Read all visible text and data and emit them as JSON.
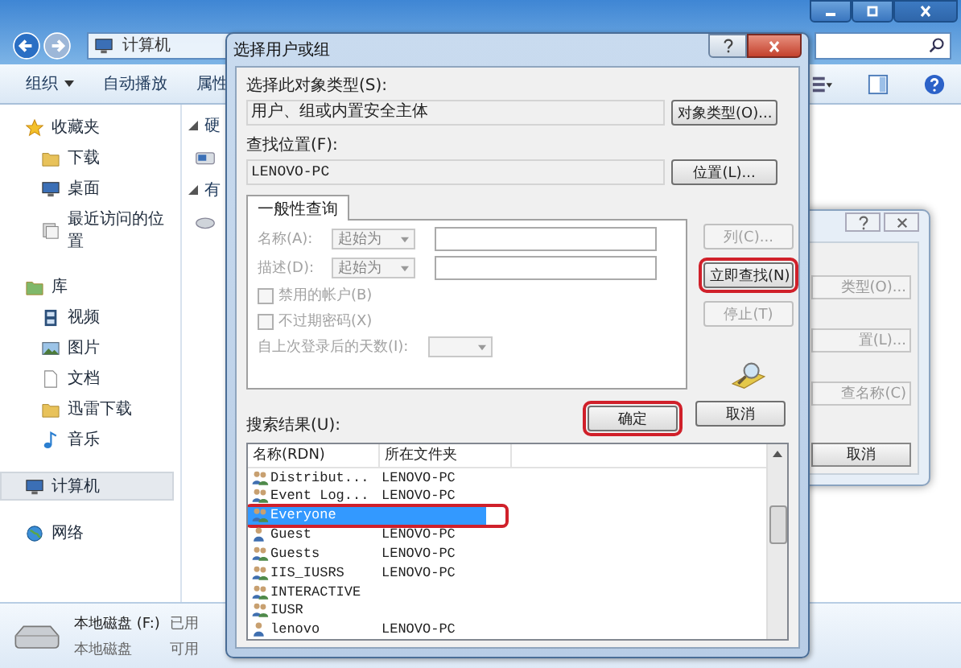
{
  "explorer": {
    "breadcrumb": "计算机",
    "toolbar": [
      {
        "label": "组织",
        "dropdown": true
      },
      {
        "label": "自动播放",
        "dropdown": false
      },
      {
        "label": "属性",
        "dropdown": false
      }
    ],
    "sidebar": [
      {
        "label": "收藏夹",
        "selected": false,
        "children": [
          {
            "label": "下载",
            "selected": false
          },
          {
            "label": "桌面",
            "selected": false
          },
          {
            "label": "最近访问的位置",
            "selected": false
          }
        ]
      },
      {
        "label": "库",
        "selected": false,
        "children": [
          {
            "label": "视频",
            "selected": false
          },
          {
            "label": "图片",
            "selected": false
          },
          {
            "label": "文档",
            "selected": false
          },
          {
            "label": "迅雷下载",
            "selected": false
          },
          {
            "label": "音乐",
            "selected": false
          }
        ]
      },
      {
        "label": "计算机",
        "selected": true
      },
      {
        "label": "网络",
        "selected": false
      }
    ],
    "content_headings": [
      "硬",
      "有"
    ],
    "details": {
      "name": "本地磁盘 (F:)",
      "type": "本地磁盘",
      "used_label": "已用",
      "free_label": "可用"
    }
  },
  "background_dialog": {
    "buttons": [
      "类型(O)...",
      "置(L)...",
      "查名称(C)",
      "取消"
    ]
  },
  "dialog": {
    "title": "选择用户或组",
    "object_type_label": "选择此对象类型(S):",
    "object_type": "用户、组或内置安全主体",
    "object_type_button": "对象类型(O)...",
    "location_label": "查找位置(F):",
    "location": "LENOVO-PC",
    "location_button": "位置(L)...",
    "tab": {
      "label": "一般性查询",
      "selected": true
    },
    "query_disabled": true,
    "query_rows": [
      {
        "label": "名称(A):",
        "operator": "起始为"
      },
      {
        "label": "描述(D):",
        "operator": "起始为"
      }
    ],
    "checkboxes": [
      {
        "label": "禁用的帐户(B)",
        "checked": false
      },
      {
        "label": "不过期密码(X)",
        "checked": false
      }
    ],
    "days_label": "自上次登录后的天数(I):",
    "side_buttons": [
      {
        "label": "列(C)...",
        "disabled": true,
        "highlighted": false
      },
      {
        "label": "立即查找(N)",
        "disabled": false,
        "highlighted": true
      },
      {
        "label": "停止(T)",
        "disabled": true,
        "highlighted": false
      }
    ],
    "footer_buttons": [
      {
        "label": "确定",
        "highlighted": true
      },
      {
        "label": "取消",
        "highlighted": false
      }
    ],
    "results_label": "搜索结果(U):",
    "columns": [
      "名称(RDN)",
      "所在文件夹"
    ],
    "rows": [
      {
        "name": "Distribut...",
        "folder": "LENOVO-PC",
        "kind": "group",
        "selected": false,
        "highlighted": false
      },
      {
        "name": "Event Log...",
        "folder": "LENOVO-PC",
        "kind": "group",
        "selected": false,
        "highlighted": false
      },
      {
        "name": "Everyone",
        "kind": "group",
        "selected": true,
        "highlighted": true
      },
      {
        "name": "Guest",
        "folder": "LENOVO-PC",
        "kind": "user",
        "selected": false,
        "highlighted": false
      },
      {
        "name": "Guests",
        "folder": "LENOVO-PC",
        "kind": "group",
        "selected": false,
        "highlighted": false
      },
      {
        "name": "IIS_IUSRS",
        "folder": "LENOVO-PC",
        "kind": "group",
        "selected": false,
        "highlighted": false
      },
      {
        "name": "INTERACTIVE",
        "kind": "group",
        "selected": false,
        "highlighted": false
      },
      {
        "name": "IUSR",
        "kind": "group",
        "selected": false,
        "highlighted": false
      },
      {
        "name": "lenovo",
        "folder": "LENOVO-PC",
        "kind": "user",
        "selected": false,
        "highlighted": false
      }
    ]
  }
}
